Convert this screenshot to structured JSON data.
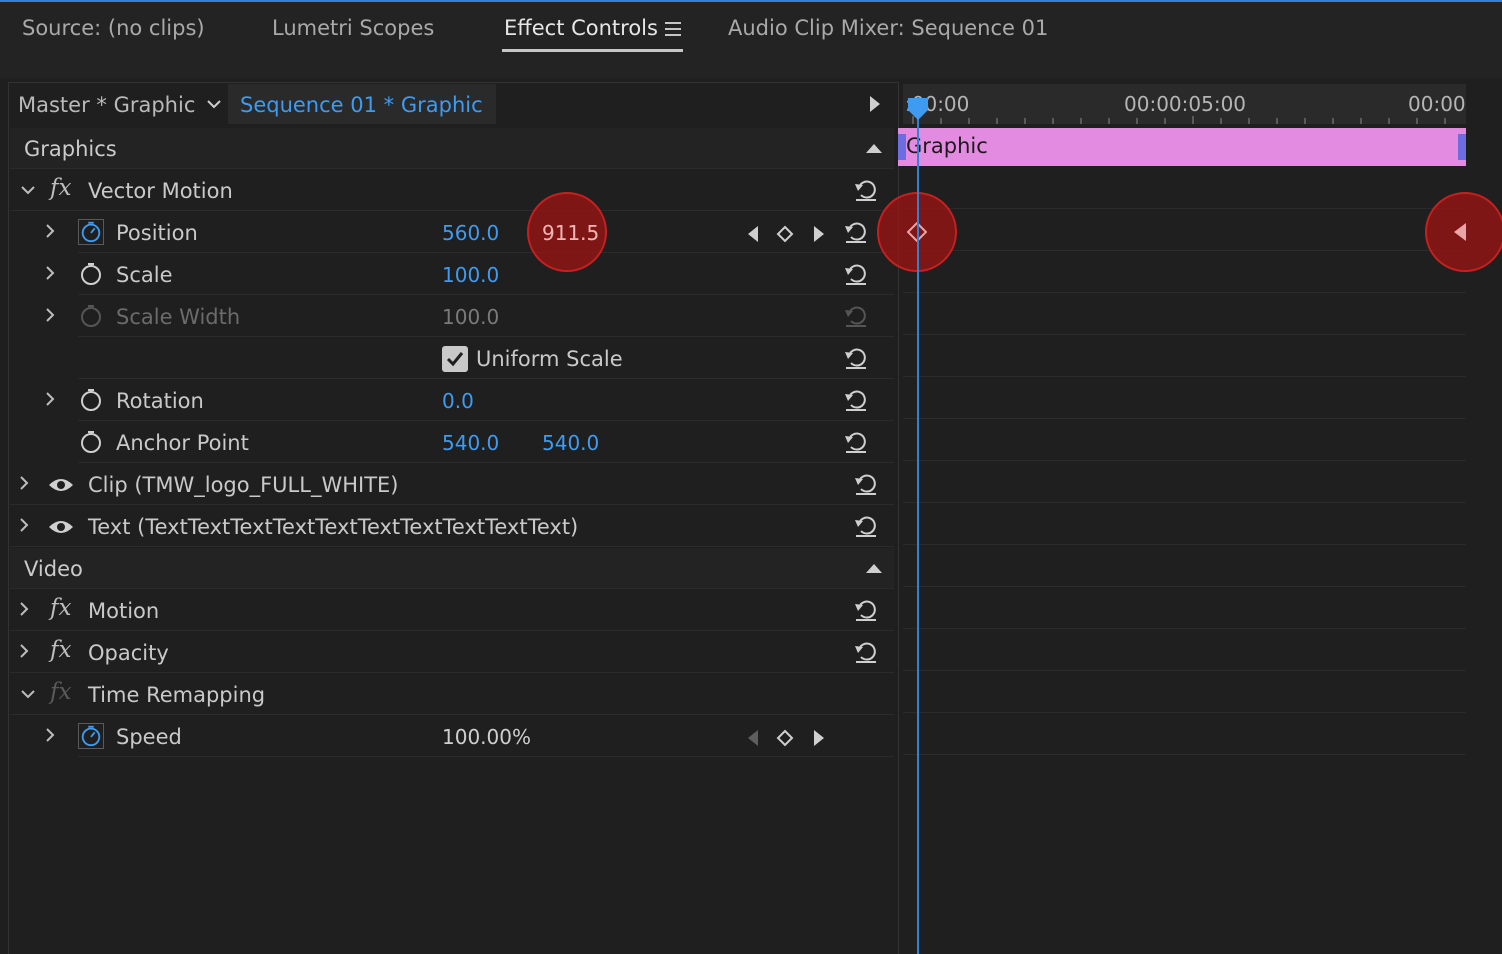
{
  "tabs": [
    {
      "label": "Source: (no clips)"
    },
    {
      "label": "Lumetri Scopes"
    },
    {
      "label": "Effect Controls"
    },
    {
      "label": "Audio Clip Mixer: Sequence 01"
    }
  ],
  "header": {
    "master_label": "Master * Graphic",
    "sequence_label": "Sequence 01 * Graphic"
  },
  "graphics_section": {
    "title": "Graphics",
    "vector_motion": {
      "title": "Vector Motion",
      "position": {
        "label": "Position",
        "x": "560.0",
        "y": "911.5"
      },
      "scale": {
        "label": "Scale",
        "value": "100.0"
      },
      "scale_width": {
        "label": "Scale Width",
        "value": "100.0"
      },
      "uniform_scale": {
        "label": "Uniform Scale",
        "checked": true
      },
      "rotation": {
        "label": "Rotation",
        "value": "0.0"
      },
      "anchor_point": {
        "label": "Anchor Point",
        "x": "540.0",
        "y": "540.0"
      }
    },
    "clip_layer": {
      "label": "Clip (TMW_logo_FULL_WHITE)"
    },
    "text_layer": {
      "label": "Text (TextTextTextTextTextTextTextTextTextText)"
    }
  },
  "video_section": {
    "title": "Video",
    "motion": {
      "label": "Motion"
    },
    "opacity": {
      "label": "Opacity"
    },
    "time_remapping": {
      "title": "Time Remapping",
      "speed": {
        "label": "Speed",
        "value": "100.00%"
      }
    }
  },
  "timeline": {
    "ruler_labels": [
      ":00:00",
      "00:00:05:00",
      "00:00"
    ],
    "clip_label": "Graphic",
    "clip_color": "#e38be0",
    "playhead_color": "#2f83d6"
  },
  "colors": {
    "accent": "#3e9bf0",
    "highlight": "#c62020"
  }
}
